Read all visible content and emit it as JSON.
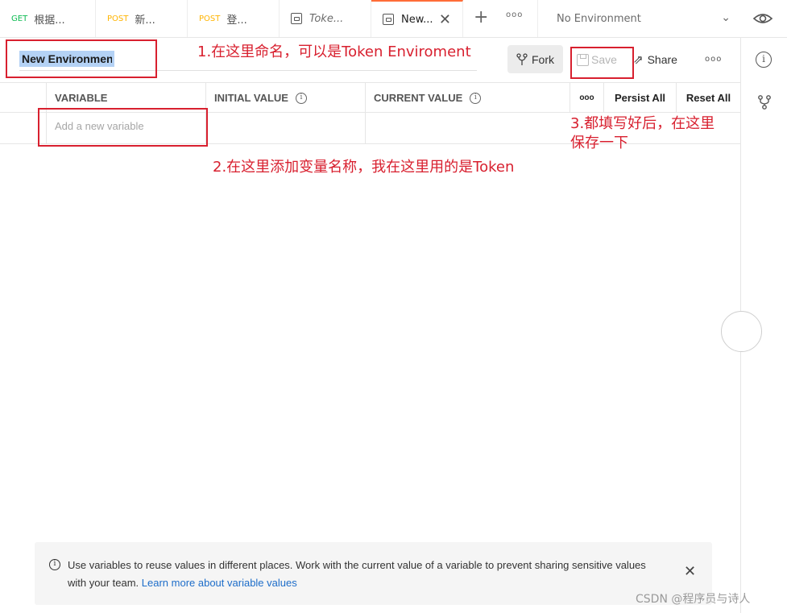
{
  "tabs": [
    {
      "method": "GET",
      "label": "根据..."
    },
    {
      "method": "POST",
      "label": "新..."
    },
    {
      "method": "POST",
      "label": "登..."
    },
    {
      "label": "Toke..."
    },
    {
      "label": "New..."
    }
  ],
  "environment_selector": {
    "value": "No Environment"
  },
  "header": {
    "name_value": "New Environment",
    "fork_label": "Fork",
    "save_label": "Save",
    "share_label": "Share"
  },
  "table": {
    "columns": {
      "variable": "VARIABLE",
      "initial_value": "INITIAL VALUE",
      "current_value": "CURRENT VALUE",
      "more": "ooo",
      "persist_all": "Persist All",
      "reset_all": "Reset All"
    },
    "new_row_placeholder": "Add a new variable"
  },
  "annotations": {
    "step1": "1.在这里命名，可以是Token Enviroment",
    "step2": "2.在这里添加变量名称，我在这里用的是Token",
    "step3_line1": "3.都填写好后，在这里",
    "step3_line2": "保存一下"
  },
  "banner": {
    "text": "Use variables to reuse values in different places. Work with the current value of a variable to prevent sharing sensitive values with your team.",
    "link": "Learn more about variable values"
  },
  "watermark": "CSDN @程序员与诗人",
  "colors": {
    "accent": "#ff6c37",
    "annotation_red": "#d8202f",
    "get_green": "#0cbb52",
    "post_orange": "#ffb400",
    "link_blue": "#1d6dc9"
  }
}
